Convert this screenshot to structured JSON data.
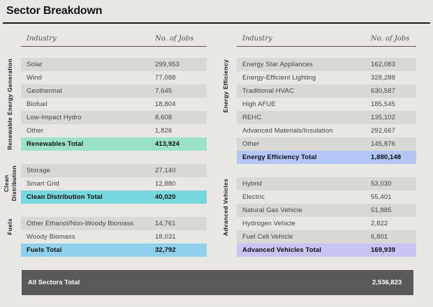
{
  "title": "Sector Breakdown",
  "headers": {
    "industry": "Industry",
    "jobs": "No. of Jobs"
  },
  "colors": {
    "background": "#e8e7e4",
    "row_alt": "#d9d8d5",
    "mint": "#99e3c4",
    "cyan": "#74d8dd",
    "sky": "#8fd0ed",
    "periwinkle": "#b3c7f7",
    "lavender": "#c7c3f3",
    "grand_bar": "#59595a"
  },
  "left_sections": [
    {
      "label": "Renewable Energy Generation",
      "rows": [
        {
          "industry": "Solar",
          "jobs": "299,953"
        },
        {
          "industry": "Wind",
          "jobs": "77,088"
        },
        {
          "industry": "Geothermal",
          "jobs": "7,645"
        },
        {
          "industry": "Biofuel",
          "jobs": "18,804"
        },
        {
          "industry": "Low-Impact Hydro",
          "jobs": "8,608"
        },
        {
          "industry": "Other",
          "jobs": "1,826"
        }
      ],
      "total": {
        "industry": "Renewables Total",
        "jobs": "413,924",
        "color": "mint"
      }
    },
    {
      "label": "Clean\nDistribution",
      "rows": [
        {
          "industry": "Storage",
          "jobs": "27,140"
        },
        {
          "industry": "Smart Grid",
          "jobs": "12,880"
        }
      ],
      "total": {
        "industry": "Clean Distribution Total",
        "jobs": "40,020",
        "color": "cyan"
      }
    },
    {
      "label": "Fuels",
      "rows": [
        {
          "industry": "Other Ethanol/Non-Woody Biomass",
          "jobs": "14,761"
        },
        {
          "industry": "Woody Biomass",
          "jobs": "18,031"
        }
      ],
      "total": {
        "industry": "Fuels Total",
        "jobs": "32,792",
        "color": "sky"
      }
    }
  ],
  "right_sections": [
    {
      "label": "Energy Efficiency",
      "rows": [
        {
          "industry": "Energy Star Appliances",
          "jobs": "162,083"
        },
        {
          "industry": "Energy-Efficient Lighting",
          "jobs": "328,288"
        },
        {
          "industry": "Traditional HVAC",
          "jobs": "630,587"
        },
        {
          "industry": "High AFUE",
          "jobs": "185,545"
        },
        {
          "industry": "REHC",
          "jobs": "135,102"
        },
        {
          "industry": "Advanced Materials/Insulation",
          "jobs": "292,667"
        },
        {
          "industry": "Other",
          "jobs": "145,876"
        }
      ],
      "total": {
        "industry": "Energy Efficiency Total",
        "jobs": "1,880,148",
        "color": "periwinkle"
      }
    },
    {
      "label": "Advanced Vehicles",
      "rows": [
        {
          "industry": "Hybrid",
          "jobs": "53,030"
        },
        {
          "industry": "Electric",
          "jobs": "55,401"
        },
        {
          "industry": "Natural Gas Vehicle",
          "jobs": "51,885"
        },
        {
          "industry": "Hydrogen Vehicle",
          "jobs": "2,822"
        },
        {
          "industry": "Fuel Cell Vehicle",
          "jobs": "6,801"
        }
      ],
      "total": {
        "industry": "Advanced Vehicles Total",
        "jobs": "169,939",
        "color": "lavender"
      }
    }
  ],
  "grand_total": {
    "label": "All Sectors Total",
    "value": "2,536,823"
  },
  "chart_data": {
    "type": "table",
    "title": "Sector Breakdown",
    "columns": [
      "Industry",
      "No. of Jobs"
    ],
    "sections": [
      {
        "sector": "Renewable Energy Generation",
        "rows": [
          [
            "Solar",
            299953
          ],
          [
            "Wind",
            77088
          ],
          [
            "Geothermal",
            7645
          ],
          [
            "Biofuel",
            18804
          ],
          [
            "Low-Impact Hydro",
            8608
          ],
          [
            "Other",
            1826
          ]
        ],
        "total": [
          "Renewables Total",
          413924
        ]
      },
      {
        "sector": "Clean Distribution",
        "rows": [
          [
            "Storage",
            27140
          ],
          [
            "Smart Grid",
            12880
          ]
        ],
        "total": [
          "Clean Distribution Total",
          40020
        ]
      },
      {
        "sector": "Fuels",
        "rows": [
          [
            "Other Ethanol/Non-Woody Biomass",
            14761
          ],
          [
            "Woody Biomass",
            18031
          ]
        ],
        "total": [
          "Fuels Total",
          32792
        ]
      },
      {
        "sector": "Energy Efficiency",
        "rows": [
          [
            "Energy Star Appliances",
            162083
          ],
          [
            "Energy-Efficient Lighting",
            328288
          ],
          [
            "Traditional HVAC",
            630587
          ],
          [
            "High AFUE",
            185545
          ],
          [
            "REHC",
            135102
          ],
          [
            "Advanced Materials/Insulation",
            292667
          ],
          [
            "Other",
            145876
          ]
        ],
        "total": [
          "Energy Efficiency Total",
          1880148
        ]
      },
      {
        "sector": "Advanced Vehicles",
        "rows": [
          [
            "Hybrid",
            53030
          ],
          [
            "Electric",
            55401
          ],
          [
            "Natural Gas Vehicle",
            51885
          ],
          [
            "Hydrogen Vehicle",
            2822
          ],
          [
            "Fuel Cell Vehicle",
            6801
          ]
        ],
        "total": [
          "Advanced Vehicles Total",
          169939
        ]
      }
    ],
    "grand_total": [
      "All Sectors Total",
      2536823
    ]
  }
}
